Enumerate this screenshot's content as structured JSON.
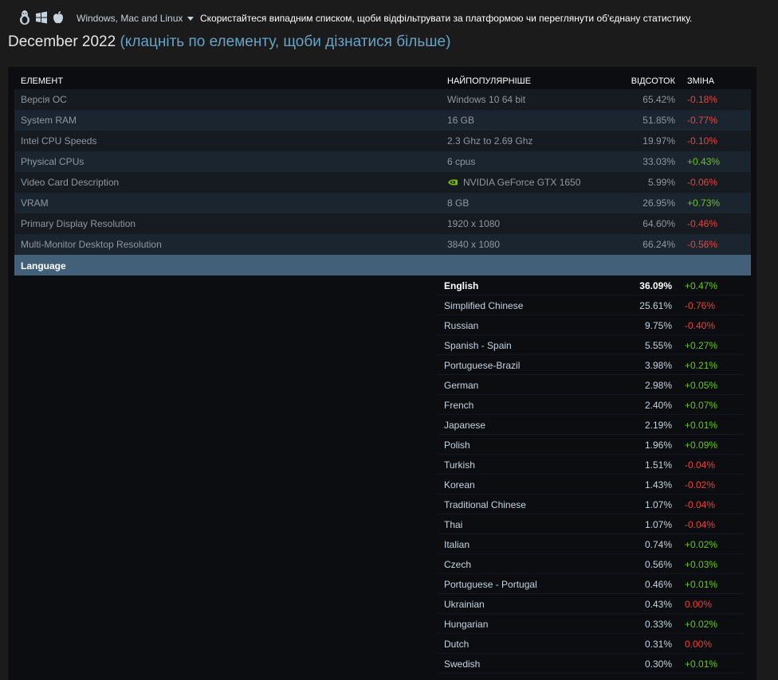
{
  "platform": {
    "icons": [
      "linux-icon",
      "windows-icon",
      "apple-icon"
    ],
    "selected": "Windows, Mac and Linux",
    "hint": "Скористайтеся випадним списком, щоби відфільтрувати за платформою чи переглянути об'єднану статистику."
  },
  "title": {
    "main": "December 2022",
    "sub": "(клацніть по елементу, щоби дізнатися більше)"
  },
  "table": {
    "headers": {
      "item": "ЕЛЕМЕНТ",
      "popular": "НАЙПОПУЛЯРНІШЕ",
      "percent": "ВІДСОТОК",
      "change": "ЗМІНА"
    },
    "rows": [
      {
        "item": "Версія ОС",
        "popular": "Windows 10 64 bit",
        "percent": "65.42%",
        "change": "-0.18%"
      },
      {
        "item": "System RAM",
        "popular": "16 GB",
        "percent": "51.85%",
        "change": "-0.77%"
      },
      {
        "item": "Intel CPU Speeds",
        "popular": "2.3 Ghz to 2.69 Ghz",
        "percent": "19.97%",
        "change": "-0.10%"
      },
      {
        "item": "Physical CPUs",
        "popular": "6 cpus",
        "percent": "33.03%",
        "change": "+0.43%"
      },
      {
        "item": "Video Card Description",
        "popular": "NVIDIA GeForce GTX 1650",
        "percent": "5.99%",
        "change": "-0.06%"
      },
      {
        "item": "VRAM",
        "popular": "8 GB",
        "percent": "26.95%",
        "change": "+0.73%"
      },
      {
        "item": "Primary Display Resolution",
        "popular": "1920 x 1080",
        "percent": "64.60%",
        "change": "-0.46%"
      },
      {
        "item": "Multi-Monitor Desktop Resolution",
        "popular": "3840 x 1080",
        "percent": "66.24%",
        "change": "-0.56%"
      }
    ]
  },
  "language": {
    "header": "Language",
    "rows": [
      {
        "name": "English",
        "percent": "36.09%",
        "change": "+0.47%"
      },
      {
        "name": "Simplified Chinese",
        "percent": "25.61%",
        "change": "-0.76%"
      },
      {
        "name": "Russian",
        "percent": "9.75%",
        "change": "-0.40%"
      },
      {
        "name": "Spanish - Spain",
        "percent": "5.55%",
        "change": "+0.27%"
      },
      {
        "name": "Portuguese-Brazil",
        "percent": "3.98%",
        "change": "+0.21%"
      },
      {
        "name": "German",
        "percent": "2.98%",
        "change": "+0.05%"
      },
      {
        "name": "French",
        "percent": "2.40%",
        "change": "+0.07%"
      },
      {
        "name": "Japanese",
        "percent": "2.19%",
        "change": "+0.01%"
      },
      {
        "name": "Polish",
        "percent": "1.96%",
        "change": "+0.09%"
      },
      {
        "name": "Turkish",
        "percent": "1.51%",
        "change": "-0.04%"
      },
      {
        "name": "Korean",
        "percent": "1.43%",
        "change": "-0.02%"
      },
      {
        "name": "Traditional Chinese",
        "percent": "1.07%",
        "change": "-0.04%"
      },
      {
        "name": "Thai",
        "percent": "1.07%",
        "change": "-0.04%"
      },
      {
        "name": "Italian",
        "percent": "0.74%",
        "change": "+0.02%"
      },
      {
        "name": "Czech",
        "percent": "0.56%",
        "change": "+0.03%"
      },
      {
        "name": "Portuguese - Portugal",
        "percent": "0.46%",
        "change": "+0.01%"
      },
      {
        "name": "Ukrainian",
        "percent": "0.43%",
        "change": "0.00%"
      },
      {
        "name": "Hungarian",
        "percent": "0.33%",
        "change": "+0.02%"
      },
      {
        "name": "Dutch",
        "percent": "0.31%",
        "change": "0.00%"
      },
      {
        "name": "Swedish",
        "percent": "0.30%",
        "change": "+0.01%"
      }
    ]
  },
  "colors": {
    "positive": "#66c71e",
    "negative": "#e9453b",
    "language_header": "#426178",
    "link": "#67a3c6"
  }
}
